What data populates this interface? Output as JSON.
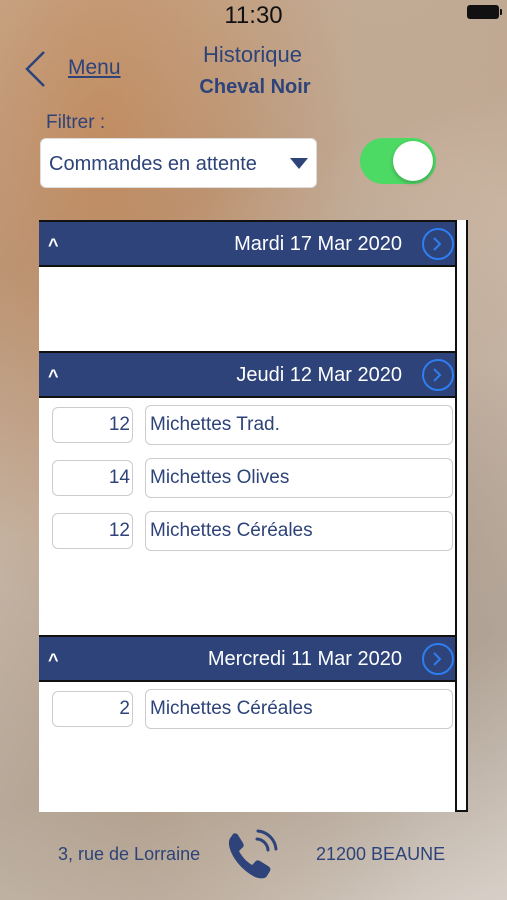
{
  "status_bar": {
    "time": "11:30"
  },
  "header": {
    "back_label": "Menu",
    "title": "Historique",
    "subtitle": "Cheval Noir"
  },
  "filter": {
    "label": "Filtrer :",
    "selected": "Commandes en attente",
    "toggle_on": true
  },
  "days": [
    {
      "date": "Mardi 17 Mar 2020",
      "items": []
    },
    {
      "date": "Jeudi 12 Mar 2020",
      "items": [
        {
          "qty": "12",
          "product": "Michettes Trad."
        },
        {
          "qty": "14",
          "product": "Michettes Olives"
        },
        {
          "qty": "12",
          "product": "Michettes Céréales"
        }
      ]
    },
    {
      "date": "Mercredi 11 Mar 2020",
      "items": [
        {
          "qty": "2",
          "product": "Michettes Céréales"
        }
      ]
    }
  ],
  "footer": {
    "address": "3, rue de Lorraine",
    "city": "21200 BEAUNE"
  },
  "colors": {
    "primary": "#2d4379",
    "toggle_on": "#4cd964",
    "accent": "#2e7ef0"
  },
  "icons": [
    "back-chevron-icon",
    "dropdown-caret-icon",
    "collapse-caret-icon",
    "chevron-right-icon",
    "phone-icon",
    "battery-icon"
  ]
}
